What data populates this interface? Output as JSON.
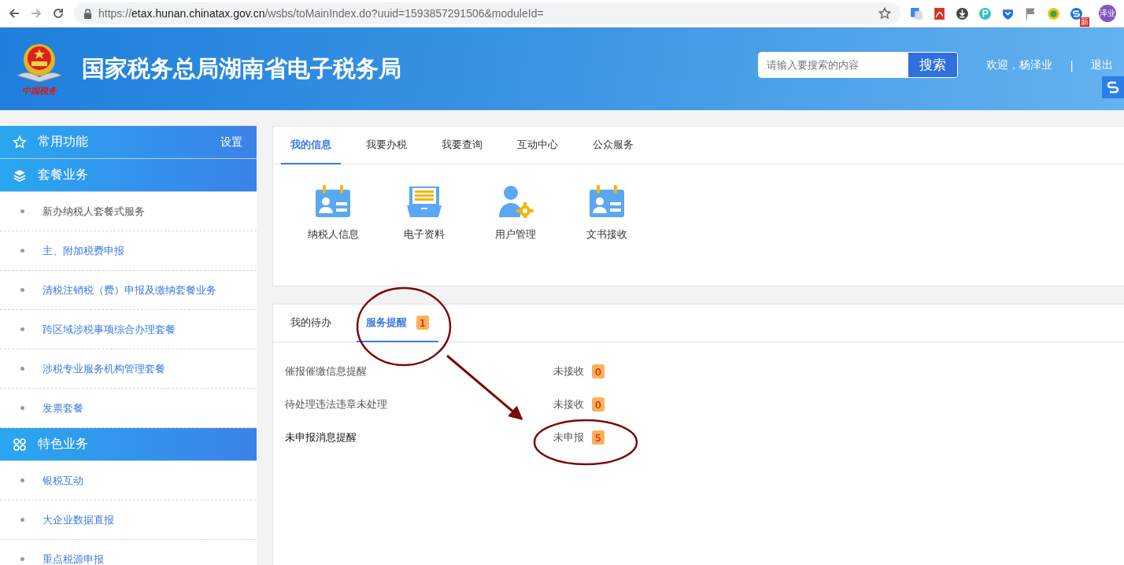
{
  "browser": {
    "url_scheme": "https://",
    "url_host": "etax.hunan.chinatax.gov.cn",
    "url_path": "/wsbs/toMainIndex.do?uuid=1593857291506&moduleId=",
    "extension_badge": "新",
    "profile": "泽业"
  },
  "header": {
    "logo_caption": "中国税务",
    "title": "国家税务总局湖南省电子税务局",
    "search": {
      "placeholder": "请输入要搜索的内容",
      "button": "搜索"
    },
    "welcome": "欢迎，杨泽业",
    "separator": "|",
    "logout": "退出"
  },
  "sidebar": {
    "sections": [
      {
        "kind": "star",
        "title": "常用功能",
        "action": "设置"
      },
      {
        "kind": "layers",
        "title": "套餐业务",
        "items": [
          {
            "label": "新办纳税人套餐式服务",
            "color": "#555555"
          },
          {
            "label": "主、附加税费申报",
            "color": "#3a7be0"
          },
          {
            "label": "清税注销税（费）申报及缴纳套餐业务",
            "color": "#3a7be0"
          },
          {
            "label": "跨区域涉税事项综合办理套餐",
            "color": "#3a7be0"
          },
          {
            "label": "涉税专业服务机构管理套餐",
            "color": "#3a7be0"
          },
          {
            "label": "发票套餐",
            "color": "#3a7be0"
          }
        ]
      },
      {
        "kind": "clover",
        "title": "特色业务",
        "items": [
          {
            "label": "银税互动",
            "color": "#3a7be0"
          },
          {
            "label": "大企业数据直报",
            "color": "#3a7be0"
          },
          {
            "label": "重点税源申报",
            "color": "#3a7be0"
          }
        ]
      }
    ]
  },
  "info_panel": {
    "tabs": [
      {
        "label": "我的信息",
        "selected": true
      },
      {
        "label": "我要办税",
        "selected": false
      },
      {
        "label": "我要查询",
        "selected": false
      },
      {
        "label": "互动中心",
        "selected": false
      },
      {
        "label": "公众服务",
        "selected": false
      }
    ],
    "shortcuts": [
      {
        "kind": "id-card",
        "label": "纳税人信息"
      },
      {
        "kind": "drawer",
        "label": "电子资料"
      },
      {
        "kind": "user-gear",
        "label": "用户管理"
      },
      {
        "kind": "id-card",
        "label": "文书接收"
      }
    ]
  },
  "reminder_panel": {
    "tabs": [
      {
        "label": "我的待办",
        "selected": false
      },
      {
        "label": "服务提醒",
        "selected": true,
        "count": "1"
      }
    ],
    "rows": [
      {
        "label": "催报催缴信息提醒",
        "status": "未接收",
        "count": "0",
        "highlighted": false
      },
      {
        "label": "待处理违法违章未处理",
        "status": "未接收",
        "count": "0",
        "highlighted": false
      },
      {
        "label": "未申报消息提醒",
        "status": "未申报",
        "count": "5",
        "highlighted": true
      }
    ]
  }
}
